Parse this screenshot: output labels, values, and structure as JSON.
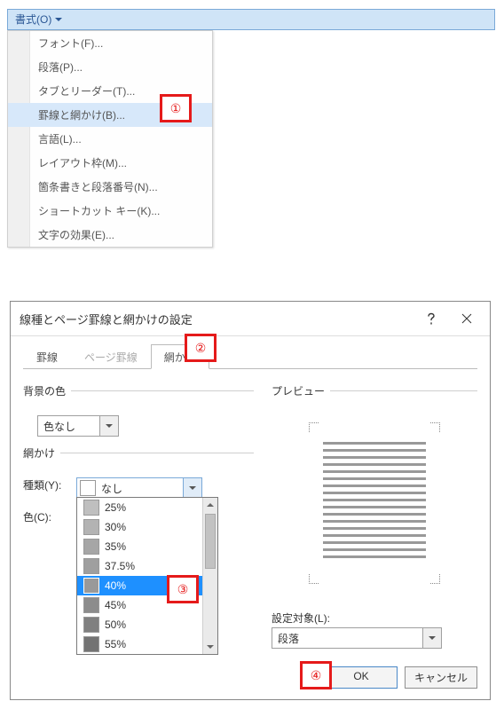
{
  "menu_button": "書式(O)",
  "menu_items": [
    "フォント(F)...",
    "段落(P)...",
    "タブとリーダー(T)...",
    "罫線と網かけ(B)...",
    "言語(L)...",
    "レイアウト枠(M)...",
    "箇条書きと段落番号(N)...",
    "ショートカット キー(K)...",
    "文字の効果(E)..."
  ],
  "menu_selected_index": 3,
  "callouts": {
    "1": "①",
    "2": "②",
    "3": "③",
    "4": "④"
  },
  "dialog": {
    "title": "線種とページ罫線と網かけの設定",
    "tabs": [
      "罫線",
      "ページ罫線",
      "網かけ"
    ],
    "active_tab_index": 2,
    "disabled_tab_index": 1,
    "bg_color_group": "背景の色",
    "bg_color_value": "色なし",
    "shading_group": "網かけ",
    "pattern_label": "種類(Y):",
    "pattern_value": "なし",
    "pattern_options": [
      "25%",
      "30%",
      "35%",
      "37.5%",
      "40%",
      "45%",
      "50%",
      "55%"
    ],
    "pattern_selected": "40%",
    "color_label": "色(C):",
    "preview_group": "プレビュー",
    "apply_to_label": "設定対象(L):",
    "apply_to_value": "段落",
    "ok": "OK",
    "cancel": "キャンセル"
  }
}
